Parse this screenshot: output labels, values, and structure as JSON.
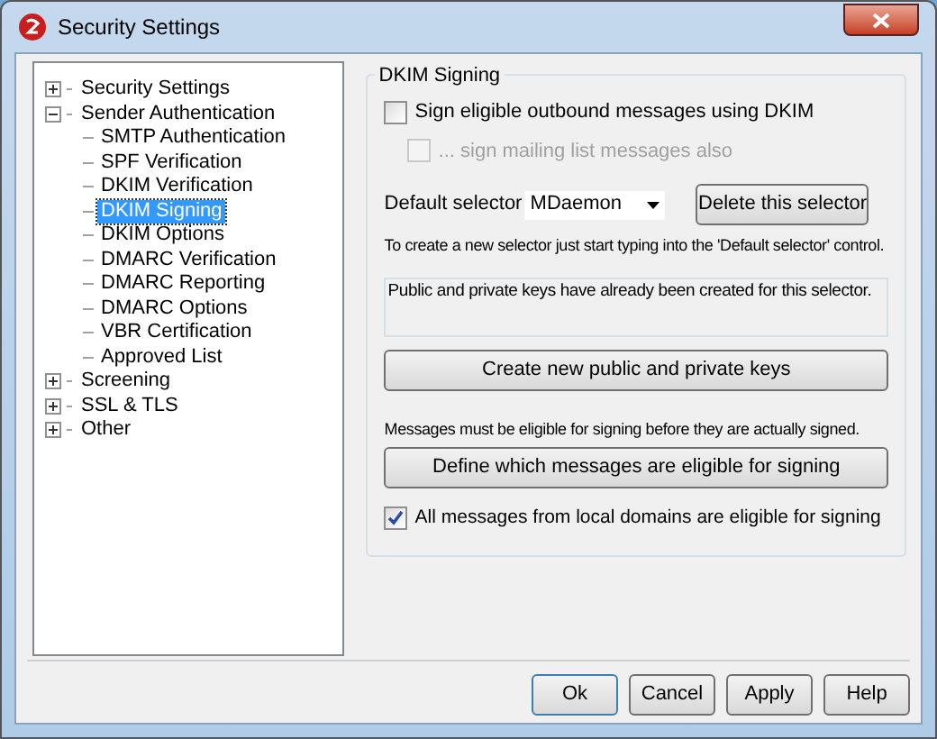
{
  "window": {
    "title": "Security Settings"
  },
  "tree": [
    {
      "label": "Security Settings",
      "expanded": false,
      "selected": false
    },
    {
      "label": "Sender Authentication",
      "expanded": true,
      "selected": false,
      "children": [
        {
          "label": "SMTP Authentication",
          "selected": false
        },
        {
          "label": "SPF Verification",
          "selected": false
        },
        {
          "label": "DKIM Verification",
          "selected": false
        },
        {
          "label": "DKIM Signing",
          "selected": true
        },
        {
          "label": "DKIM Options",
          "selected": false
        },
        {
          "label": "DMARC Verification",
          "selected": false
        },
        {
          "label": "DMARC Reporting",
          "selected": false
        },
        {
          "label": "DMARC Options",
          "selected": false
        },
        {
          "label": "VBR Certification",
          "selected": false
        },
        {
          "label": "Approved List",
          "selected": false
        }
      ]
    },
    {
      "label": "Screening",
      "expanded": false,
      "selected": false
    },
    {
      "label": "SSL & TLS",
      "expanded": false,
      "selected": false
    },
    {
      "label": "Other",
      "expanded": false,
      "selected": false
    }
  ],
  "group": {
    "title": "DKIM Signing",
    "sign_checkbox": {
      "label": "Sign eligible outbound messages using DKIM",
      "checked": false,
      "disabled": false
    },
    "mailing_checkbox": {
      "label": "... sign mailing list messages also",
      "checked": false,
      "disabled": true
    },
    "selector_label": "Default selector",
    "selector_value": "MDaemon",
    "delete_button": "Delete this selector",
    "hint": "To create a new selector just start typing into the 'Default selector' control.",
    "status_text": "Public and private keys have already been created for this selector.",
    "create_button": "Create new public and private keys",
    "eligible_note": "Messages must be eligible for signing before they are actually signed.",
    "define_button": "Define which messages are eligible for signing",
    "local_checkbox": {
      "label": "All messages from local domains are eligible for signing",
      "checked": true,
      "disabled": false
    }
  },
  "buttons": [
    "Ok",
    "Cancel",
    "Apply",
    "Help"
  ]
}
